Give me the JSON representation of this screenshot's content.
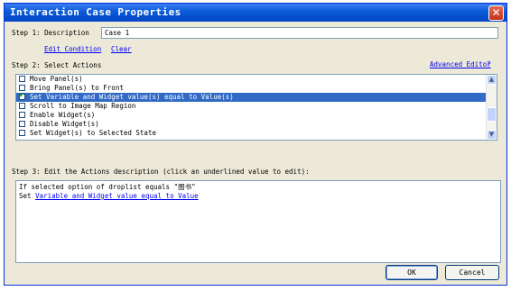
{
  "window": {
    "title": "Interaction Case Properties",
    "close_glyph": "✕"
  },
  "step1": {
    "label": "Step 1: Description",
    "description_value": "Case 1",
    "edit_condition": "Edit Condition",
    "clear": "Clear"
  },
  "step2": {
    "label": "Step 2: Select Actions",
    "advanced_editor": "Advanced Editor",
    "help": "?",
    "actions": [
      {
        "label": "Move Panel(s)",
        "checked": false,
        "selected": false
      },
      {
        "label": "Bring Panel(s) to Front",
        "checked": false,
        "selected": false
      },
      {
        "label": "Set Variable and Widget value(s) equal to Value(s)",
        "checked": true,
        "selected": true
      },
      {
        "label": "Scroll to Image Map Region",
        "checked": false,
        "selected": false
      },
      {
        "label": "Enable Widget(s)",
        "checked": false,
        "selected": false
      },
      {
        "label": "Disable Widget(s)",
        "checked": false,
        "selected": false
      },
      {
        "label": "Set Widget(s) to Selected State",
        "checked": false,
        "selected": false
      }
    ]
  },
  "step3": {
    "label": "Step 3: Edit the Actions description (click an underlined value to edit):",
    "line1": "If selected option of droplist equals \"图书\"",
    "line2_prefix": "Set ",
    "line2_link": "Variable and Widget value equal to Value"
  },
  "buttons": {
    "ok": "OK",
    "cancel": "Cancel"
  },
  "icons": {
    "close": "close-icon",
    "scroll_up": "chevron-up-icon",
    "scroll_down": "chevron-down-icon",
    "check": "checkmark-icon"
  }
}
